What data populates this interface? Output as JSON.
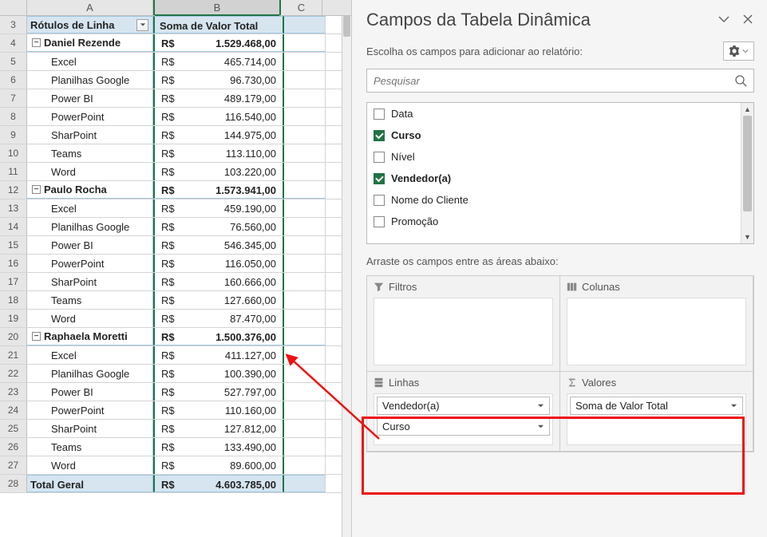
{
  "columns": [
    "A",
    "B",
    "C"
  ],
  "headers": {
    "rowlabel": "Rótulos de Linha",
    "sumvalue": "Soma de Valor Total"
  },
  "currency": "R$",
  "data": [
    {
      "row": 4,
      "type": "group",
      "label": "Daniel Rezende",
      "value": "1.529.468,00"
    },
    {
      "row": 5,
      "type": "detail",
      "label": "Excel",
      "value": "465.714,00"
    },
    {
      "row": 6,
      "type": "detail",
      "label": "Planilhas Google",
      "value": "96.730,00"
    },
    {
      "row": 7,
      "type": "detail",
      "label": "Power BI",
      "value": "489.179,00"
    },
    {
      "row": 8,
      "type": "detail",
      "label": "PowerPoint",
      "value": "116.540,00"
    },
    {
      "row": 9,
      "type": "detail",
      "label": "SharPoint",
      "value": "144.975,00"
    },
    {
      "row": 10,
      "type": "detail",
      "label": "Teams",
      "value": "113.110,00"
    },
    {
      "row": 11,
      "type": "detail",
      "label": "Word",
      "value": "103.220,00"
    },
    {
      "row": 12,
      "type": "group",
      "label": "Paulo Rocha",
      "value": "1.573.941,00"
    },
    {
      "row": 13,
      "type": "detail",
      "label": "Excel",
      "value": "459.190,00"
    },
    {
      "row": 14,
      "type": "detail",
      "label": "Planilhas Google",
      "value": "76.560,00"
    },
    {
      "row": 15,
      "type": "detail",
      "label": "Power BI",
      "value": "546.345,00"
    },
    {
      "row": 16,
      "type": "detail",
      "label": "PowerPoint",
      "value": "116.050,00"
    },
    {
      "row": 17,
      "type": "detail",
      "label": "SharPoint",
      "value": "160.666,00"
    },
    {
      "row": 18,
      "type": "detail",
      "label": "Teams",
      "value": "127.660,00"
    },
    {
      "row": 19,
      "type": "detail",
      "label": "Word",
      "value": "87.470,00"
    },
    {
      "row": 20,
      "type": "group",
      "label": "Raphaela Moretti",
      "value": "1.500.376,00"
    },
    {
      "row": 21,
      "type": "detail",
      "label": "Excel",
      "value": "411.127,00"
    },
    {
      "row": 22,
      "type": "detail",
      "label": "Planilhas Google",
      "value": "100.390,00"
    },
    {
      "row": 23,
      "type": "detail",
      "label": "Power BI",
      "value": "527.797,00"
    },
    {
      "row": 24,
      "type": "detail",
      "label": "PowerPoint",
      "value": "110.160,00"
    },
    {
      "row": 25,
      "type": "detail",
      "label": "SharPoint",
      "value": "127.812,00"
    },
    {
      "row": 26,
      "type": "detail",
      "label": "Teams",
      "value": "133.490,00"
    },
    {
      "row": 27,
      "type": "detail",
      "label": "Word",
      "value": "89.600,00"
    },
    {
      "row": 28,
      "type": "total",
      "label": "Total Geral",
      "value": "4.603.785,00"
    }
  ],
  "pane": {
    "title": "Campos da Tabela Dinâmica",
    "subtitle": "Escolha os campos para adicionar ao relatório:",
    "search_placeholder": "Pesquisar",
    "fields": [
      {
        "name": "Data",
        "checked": false
      },
      {
        "name": "Curso",
        "checked": true
      },
      {
        "name": "Nível",
        "checked": false
      },
      {
        "name": "Vendedor(a)",
        "checked": true
      },
      {
        "name": "Nome do Cliente",
        "checked": false
      },
      {
        "name": "Promoção",
        "checked": false
      }
    ],
    "drag_label": "Arraste os campos entre as áreas abaixo:",
    "areas": {
      "filters": "Filtros",
      "columns": "Colunas",
      "rows": "Linhas",
      "values": "Valores"
    },
    "row_pills": [
      "Vendedor(a)",
      "Curso"
    ],
    "value_pills": [
      "Soma de Valor Total"
    ]
  }
}
